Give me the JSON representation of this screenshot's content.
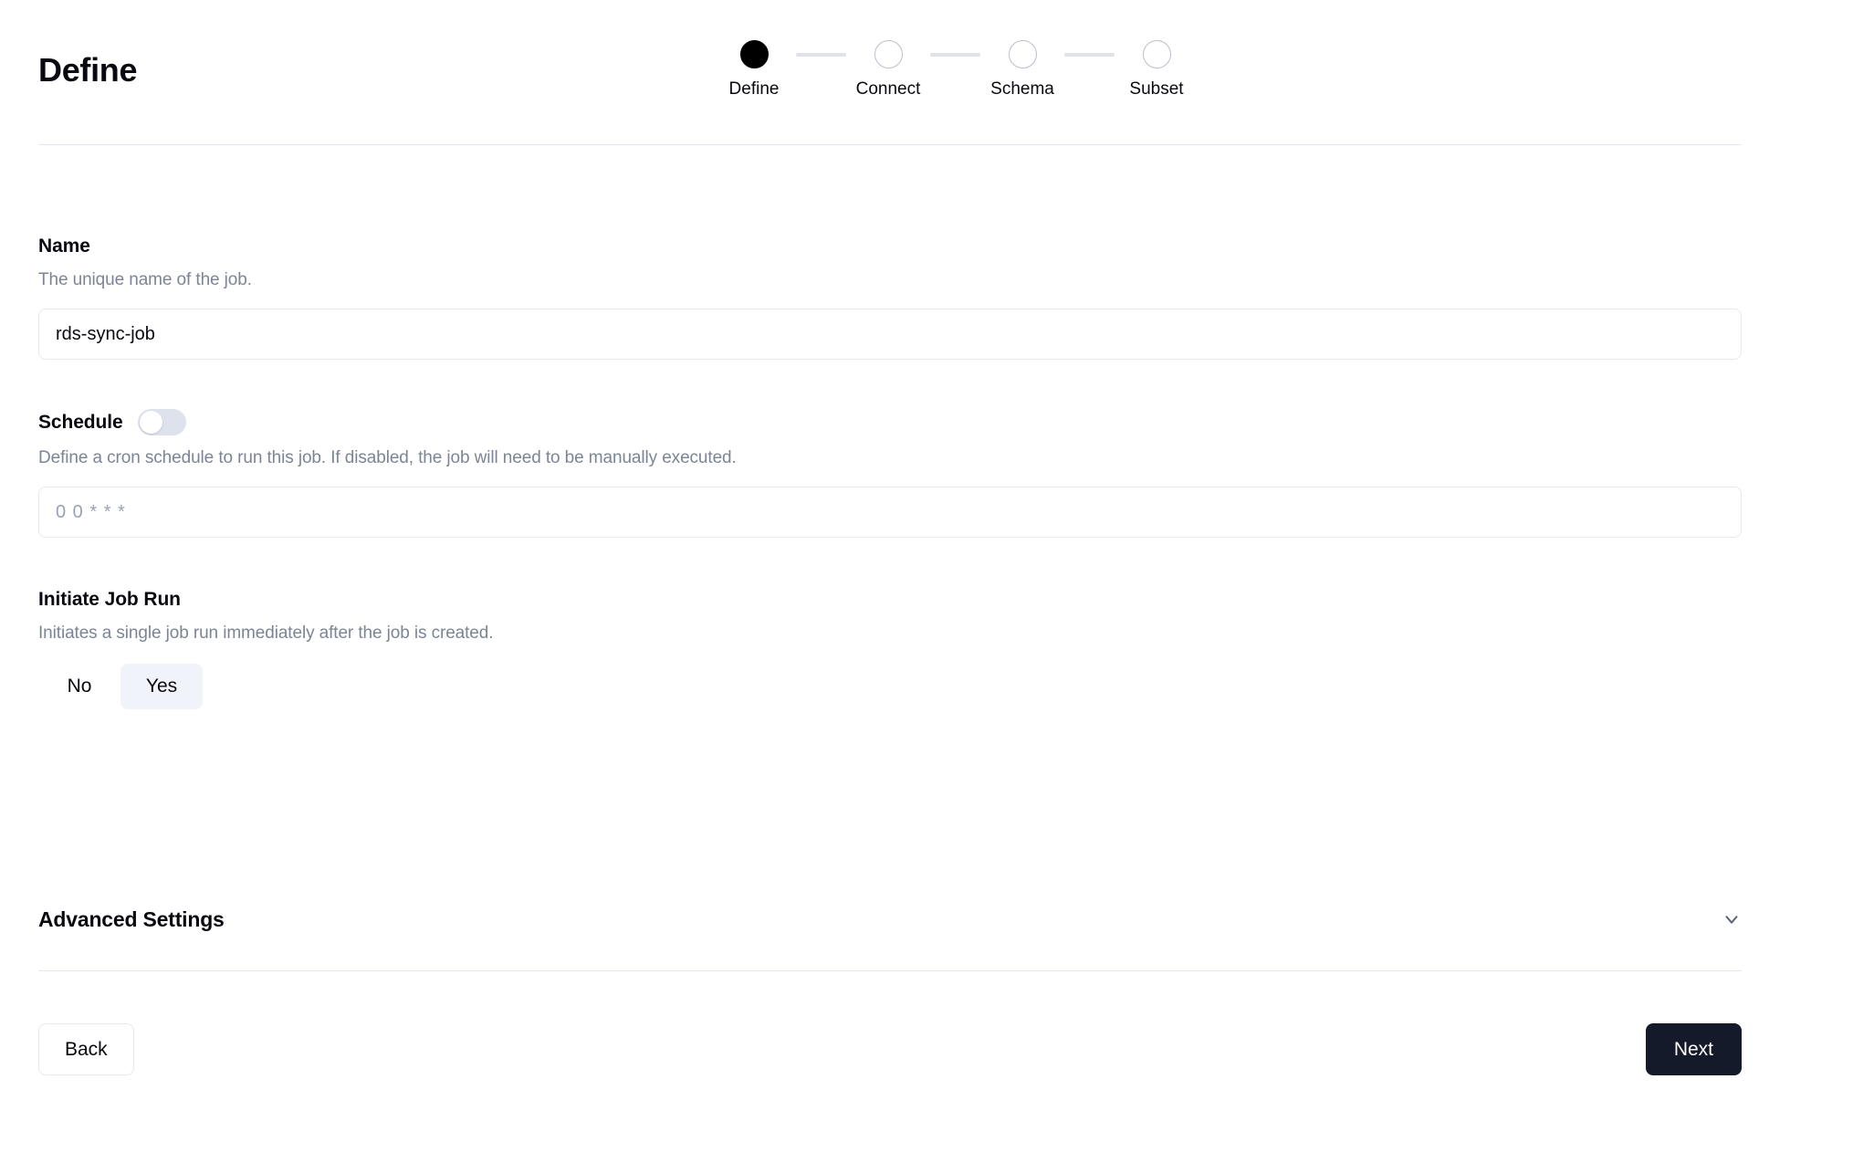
{
  "header": {
    "title": "Define"
  },
  "stepper": {
    "steps": [
      {
        "label": "Define",
        "state": "active"
      },
      {
        "label": "Connect",
        "state": "inactive"
      },
      {
        "label": "Schema",
        "state": "inactive"
      },
      {
        "label": "Subset",
        "state": "inactive"
      }
    ]
  },
  "form": {
    "name": {
      "label": "Name",
      "description": "The unique name of the job.",
      "value": "rds-sync-job",
      "placeholder": ""
    },
    "schedule": {
      "label": "Schedule",
      "description": "Define a cron schedule to run this job. If disabled, the job will need to be manually executed.",
      "toggle_state": "off",
      "cron_value": "",
      "cron_placeholder": "0 0 * * *"
    },
    "initiate_job_run": {
      "label": "Initiate Job Run",
      "description": "Initiates a single job run immediately after the job is created.",
      "options": [
        "No",
        "Yes"
      ],
      "selected": "Yes"
    }
  },
  "advanced_settings": {
    "title": "Advanced Settings",
    "expanded": false,
    "chevron": "chevron-down-icon"
  },
  "footer": {
    "back_label": "Back",
    "next_label": "Next"
  },
  "colors": {
    "accent_dark": "#141a2a",
    "active_step": "#000000",
    "muted_text": "#7c8496",
    "border": "#e6e9f0",
    "selected_bg": "#f0f3f9",
    "switch_track": "#dee2ec"
  }
}
